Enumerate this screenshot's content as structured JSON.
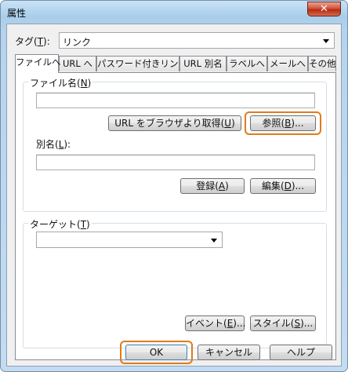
{
  "window": {
    "title": "属性",
    "close_glyph": "✕"
  },
  "tag_row": {
    "label_pre": "タグ(",
    "label_key": "T",
    "label_post": "):",
    "value": "リンク"
  },
  "tabs": [
    {
      "label": "ファイルへ",
      "active": true
    },
    {
      "label": "URL へ"
    },
    {
      "label": "パスワード付きリンク"
    },
    {
      "label": "URL 別名"
    },
    {
      "label": "ラベルへ"
    },
    {
      "label": "メールへ"
    },
    {
      "label": "その他"
    }
  ],
  "file_group": {
    "label_pre": "ファイル名(",
    "label_key": "N",
    "label_post": ")",
    "value": "",
    "browser_btn_pre": "URL をブラウザより取得(",
    "browser_btn_key": "U",
    "browser_btn_post": ")",
    "browse_btn_pre": "参照(",
    "browse_btn_key": "B",
    "browse_btn_post": ")..."
  },
  "alias": {
    "label_pre": "別名(",
    "label_key": "L",
    "label_post": "):",
    "value": "",
    "register_pre": "登録(",
    "register_key": "A",
    "register_post": ")",
    "edit_pre": "編集(",
    "edit_key": "D",
    "edit_post": ")..."
  },
  "target_group": {
    "label_pre": "ターゲット(",
    "label_key": "T",
    "label_post": ")",
    "value": ""
  },
  "extra_buttons": {
    "event_pre": "イベント(",
    "event_key": "E",
    "event_post": ")...",
    "style_pre": "スタイル(",
    "style_key": "S",
    "style_post": ")..."
  },
  "footer": {
    "ok": "OK",
    "cancel": "キャンセル",
    "help": "ヘルプ"
  },
  "colors": {
    "highlight": "#e07b1a",
    "close_button": "#c8452a"
  }
}
